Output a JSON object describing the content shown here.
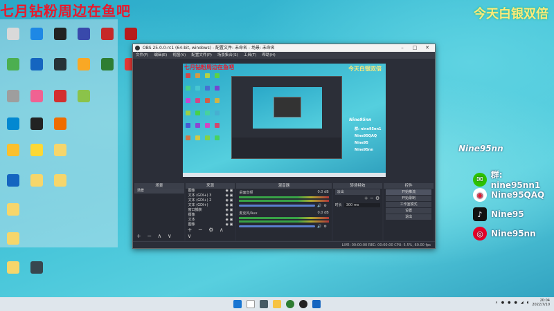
{
  "overlay": {
    "left_title": "七月钻粉周边在鱼吧",
    "right_title": "今天白银双倍"
  },
  "desktop": {
    "icons": [
      {
        "label": "",
        "color": "#d9d9d9"
      },
      {
        "label": "",
        "color": "#1e88e5"
      },
      {
        "label": "",
        "color": "#222"
      },
      {
        "label": "",
        "color": "#3949ab"
      },
      {
        "label": "",
        "color": "#c62828"
      },
      {
        "label": "",
        "color": "#b71c1c"
      },
      {
        "label": "",
        "color": "#4caf50"
      },
      {
        "label": "",
        "color": "#1565c0"
      },
      {
        "label": "",
        "color": "#263238"
      },
      {
        "label": "",
        "color": "#f9a825"
      },
      {
        "label": "",
        "color": "#2e7d32"
      },
      {
        "label": "",
        "color": "#e53935"
      },
      {
        "label": "",
        "color": "#9e9e9e"
      },
      {
        "label": "",
        "color": "#f06292"
      },
      {
        "label": "",
        "color": "#d32f2f"
      },
      {
        "label": "",
        "color": "#8bc34a"
      },
      {
        "label": "",
        "color": "#0288d1"
      },
      {
        "label": "",
        "color": "#222"
      },
      {
        "label": "",
        "color": "#ef6c00"
      },
      {
        "label": "",
        "color": "#fbc02d"
      },
      {
        "label": "",
        "color": "#fdd835"
      },
      {
        "label": "",
        "color": "#f6d66b"
      },
      {
        "label": "",
        "color": "#1565c0"
      },
      {
        "label": "",
        "color": "#f6d66b"
      },
      {
        "label": "",
        "color": "#f6d66b"
      },
      {
        "label": "",
        "color": "#f6d66b"
      },
      {
        "label": "",
        "color": "#f6d66b"
      },
      {
        "label": "",
        "color": "#f6d66b"
      },
      {
        "label": "",
        "color": "#37474f"
      }
    ]
  },
  "obs": {
    "title": "OBS 25.0.0-rc1 (64-bit, windows) - 配置文件: 未命名 - 场景: 未命名",
    "menu": [
      "文件(F)",
      "编辑(E)",
      "视图(V)",
      "配置文件(P)",
      "场景集合(S)",
      "工具(T)",
      "帮助(H)"
    ],
    "preview_left": "七月钻粉周边在鱼吧",
    "preview_right": "今天白银双倍",
    "preview_nine": "Nine95nn",
    "preview_socials": [
      "群: nine95nn1",
      "Nine95QAQ",
      "Nine95",
      "Nine95nn"
    ],
    "docks": {
      "scenes": "场景",
      "sources": "来源",
      "mixer": "混音器",
      "transitions": "转场特效",
      "controls": "控件"
    },
    "scene_item": "场景",
    "sources_list": [
      "图像",
      "文本 (GDI+) 3",
      "文本 (GDI+) 2",
      "文本 (GDI+)",
      "窗口捕获",
      "摄像",
      "文本",
      "图像"
    ],
    "mixer_channels": [
      {
        "name": "桌面音频",
        "db": "0.0 dB"
      },
      {
        "name": "麦克风/Aux",
        "db": "0.0 dB"
      }
    ],
    "transition": {
      "type": "淡出",
      "duration_label": "时长",
      "duration": "300 ms"
    },
    "controls": [
      "开始推流",
      "开始录制",
      "工作室模式",
      "设置",
      "退出"
    ],
    "status": "LIVE: 00:00:00    REC: 00:00:00    CPU: 5.5%, 60.00 fps"
  },
  "social": {
    "title": "Nine95nn",
    "items": [
      {
        "icon": "wechat-icon",
        "text": "群: nine95nn1",
        "color": "#2dc100"
      },
      {
        "icon": "weibo-icon",
        "text": "Nine95QAQ",
        "color": "#ffffff"
      },
      {
        "icon": "tiktok-icon",
        "text": "Nine95",
        "color": "#111111"
      },
      {
        "icon": "netease-icon",
        "text": "Nine95nn",
        "color": "#e60026"
      }
    ]
  },
  "taskbar": {
    "time": "20:04",
    "date": "2022/7/10"
  }
}
